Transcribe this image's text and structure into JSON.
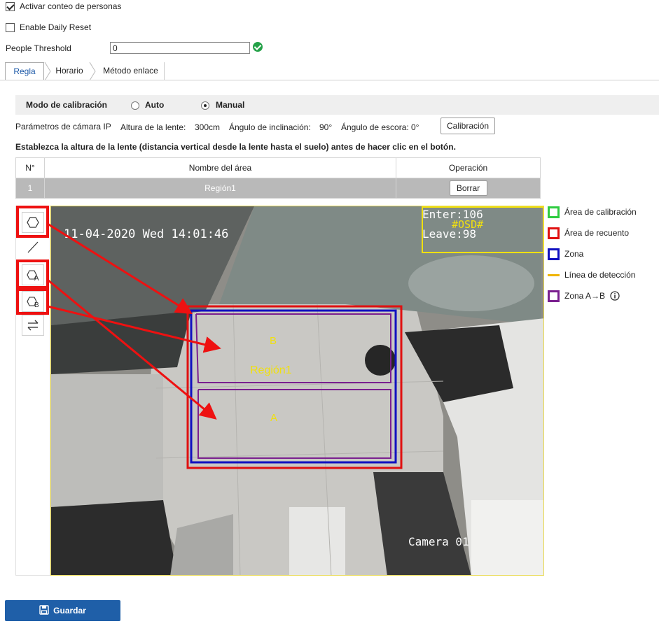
{
  "settings": {
    "counting_label": "Activar conteo de personas",
    "counting_checked": true,
    "daily_reset_label": "Enable Daily Reset",
    "daily_reset_checked": false,
    "threshold_label": "People Threshold",
    "threshold_value": "0"
  },
  "tabs": [
    {
      "label": "Regla",
      "active": true
    },
    {
      "label": "Horario",
      "active": false
    },
    {
      "label": "Método enlace",
      "active": false
    }
  ],
  "calibration": {
    "mode_label": "Modo de calibración",
    "auto_label": "Auto",
    "manual_label": "Manual",
    "selected": "Manual",
    "params_label": "Parámetros de cámara IP",
    "lens_height_label": "Altura de la lente:",
    "lens_height_value": "300cm",
    "tilt_label": "Ángulo de inclinación:",
    "tilt_value": "90°",
    "roll_label": "Ángulo de escora:",
    "roll_value": "0°",
    "calibrate_button": "Calibración",
    "instruction": "Establezca la altura de la lente (distancia vertical desde la lente hasta el suelo) antes de hacer clic en el botón."
  },
  "area_table": {
    "headers": [
      "N°",
      "Nombre del área",
      "Operación"
    ],
    "rows": [
      {
        "num": "1",
        "name": "Región1",
        "operation": "Borrar"
      }
    ]
  },
  "video": {
    "timestamp": "11-04-2020 Wed 14:01:46",
    "enter_text": "Enter:106",
    "leave_text": "Leave:98",
    "osd_text": "#OSD#",
    "camera_name": "Camera 01",
    "region_label": "Región1",
    "zone_a_label": "A",
    "zone_b_label": "B"
  },
  "legend": [
    {
      "label": "Área de calibración",
      "color": "#2ecc40",
      "kind": "box"
    },
    {
      "label": "Área de recuento",
      "color": "#e01010",
      "kind": "box"
    },
    {
      "label": "Zona",
      "color": "#1010c0",
      "kind": "box"
    },
    {
      "label": "Línea de detección",
      "color": "#f0b400",
      "kind": "line"
    },
    {
      "label": "Zona A→B",
      "color": "#7a1f8f",
      "kind": "box"
    }
  ],
  "toolbar": {
    "tools": [
      "polygon-icon",
      "line-icon",
      "polygon-a-icon",
      "polygon-b-icon",
      "swap-direction-icon"
    ]
  },
  "save_button": "Guardar"
}
